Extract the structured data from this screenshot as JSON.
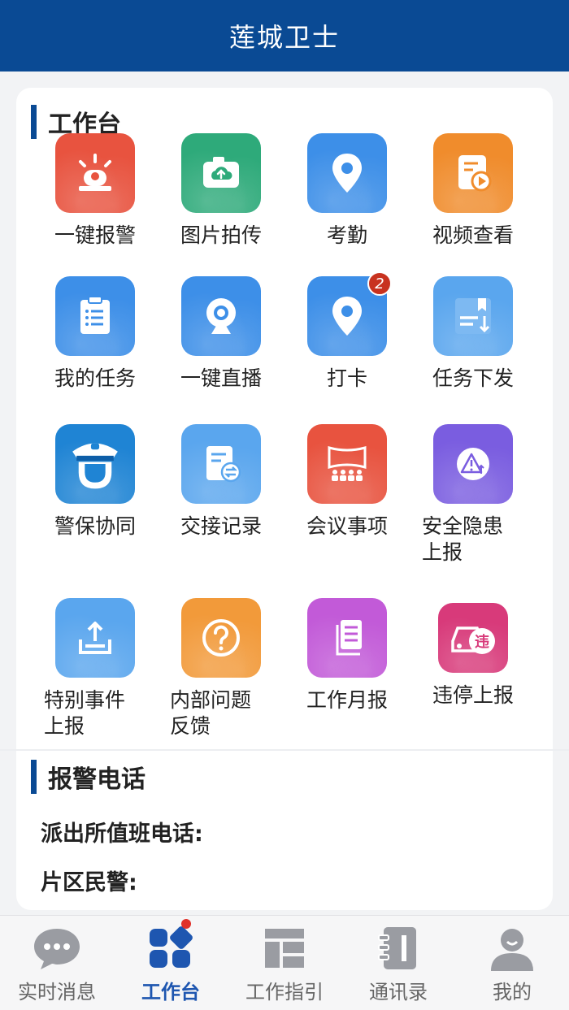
{
  "header": {
    "title": "莲城卫士"
  },
  "workbench": {
    "section_title": "工作台",
    "items": [
      {
        "label": "一键报警",
        "icon": "alarm-siren-icon",
        "color": "#e8533f"
      },
      {
        "label": "图片拍传",
        "icon": "camera-upload-icon",
        "color": "#2eaa7a"
      },
      {
        "label": "考勤",
        "icon": "location-pin-icon",
        "color": "#3d8fe8"
      },
      {
        "label": "视频查看",
        "icon": "video-doc-icon",
        "color": "#f08c2c"
      },
      {
        "label": "我的任务",
        "icon": "clipboard-icon",
        "color": "#3d8fe8"
      },
      {
        "label": "一键直播",
        "icon": "webcam-icon",
        "color": "#3d8fe8"
      },
      {
        "label": "打卡",
        "icon": "location-pin-icon",
        "color": "#3d8fe8",
        "badge": "2"
      },
      {
        "label": "任务下发",
        "icon": "task-dispatch-icon",
        "color": "#5aa6ee"
      },
      {
        "label": "警保协同",
        "icon": "police-officer-icon",
        "color": "#1f84d4"
      },
      {
        "label": "交接记录",
        "icon": "handover-doc-icon",
        "color": "#5aa6ee"
      },
      {
        "label": "会议事项",
        "icon": "meeting-icon",
        "color": "#e8533f"
      },
      {
        "label": "安全隐患\n上报",
        "icon": "warning-triangle-icon",
        "color": "#7a5de0"
      },
      {
        "label": "特别事件\n上报",
        "icon": "tray-upload-icon",
        "color": "#5aa6ee"
      },
      {
        "label": "内部问题\n反馈",
        "icon": "question-icon",
        "color": "#f29a3a"
      },
      {
        "label": "工作月报",
        "icon": "report-pages-icon",
        "color": "#c25ad8"
      },
      {
        "label": "违停上报",
        "icon": "illegal-parking-icon",
        "color": "#d83a7a"
      }
    ]
  },
  "alarm_phone": {
    "section_title": "报警电话",
    "station_label": "派出所值班电话:",
    "officer_label": "片区民警:"
  },
  "bottom_nav": {
    "items": [
      {
        "label": "实时消息",
        "icon": "chat-bubble-icon",
        "active": false
      },
      {
        "label": "工作台",
        "icon": "workbench-grid-icon",
        "active": true
      },
      {
        "label": "工作指引",
        "icon": "guide-layout-icon",
        "active": false
      },
      {
        "label": "通讯录",
        "icon": "contacts-book-icon",
        "active": false
      },
      {
        "label": "我的",
        "icon": "user-profile-icon",
        "active": false
      }
    ]
  },
  "colors": {
    "primary": "#0a4a94",
    "active_nav": "#1e56b0",
    "badge": "#c8321f"
  }
}
